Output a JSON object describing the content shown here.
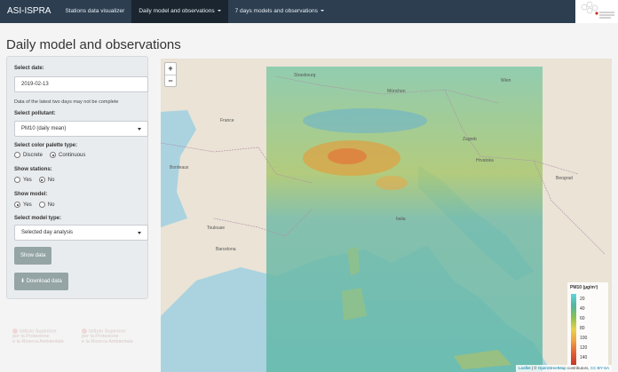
{
  "navbar": {
    "brand": "ASI-ISPRA",
    "items": [
      {
        "label": "Stations data visualizer"
      },
      {
        "label": "Daily model and observations"
      },
      {
        "label": "7 days models and observations"
      }
    ]
  },
  "page_title": "Daily model and observations",
  "form": {
    "date_label": "Select date:",
    "date_value": "2019-02-13",
    "date_note": "Data of the latest two days may not be complete",
    "pollutant_label": "Select pollutant:",
    "pollutant_value": "PM10 (daily mean)",
    "palette_label": "Select color palette type:",
    "palette_options": [
      "Discrete",
      "Continuous"
    ],
    "palette_selected": "Continuous",
    "stations_label": "Show stations:",
    "stations_options": [
      "Yes",
      "No"
    ],
    "stations_selected": "No",
    "model_label": "Show model:",
    "model_options": [
      "Yes",
      "No"
    ],
    "model_selected": "Yes",
    "model_type_label": "Select model type:",
    "model_type_value": "Selected day analysis",
    "show_button": "Show data",
    "download_button": "Download data"
  },
  "map": {
    "zoom_in": "+",
    "zoom_out": "−",
    "legend": {
      "title": "PM10 (µg/m³)",
      "ticks": [
        "20",
        "40",
        "60",
        "80",
        "100",
        "120",
        "140"
      ]
    },
    "attribution": {
      "leaflet": "Leaflet",
      "sep": " | © ",
      "osm": "OpenStreetMap",
      "rest": " contributors, ",
      "license": "CC-BY-SA"
    },
    "places": [
      "Strasbourg",
      "München",
      "Wien",
      "France",
      "Bordeaux",
      "Toulouse",
      "Barcelona",
      "Zagreb",
      "Beograd",
      "Hrvatska",
      "Italia"
    ]
  },
  "watermark": {
    "line1": "Istituto Superiore",
    "line2": "per la Protezione",
    "line3": "e la Ricerca Ambientale"
  },
  "colors": {
    "navbar": "#2c3e50",
    "navbar_active": "#1a252f",
    "button": "#95a5a6",
    "panel": "#e9ecef"
  }
}
